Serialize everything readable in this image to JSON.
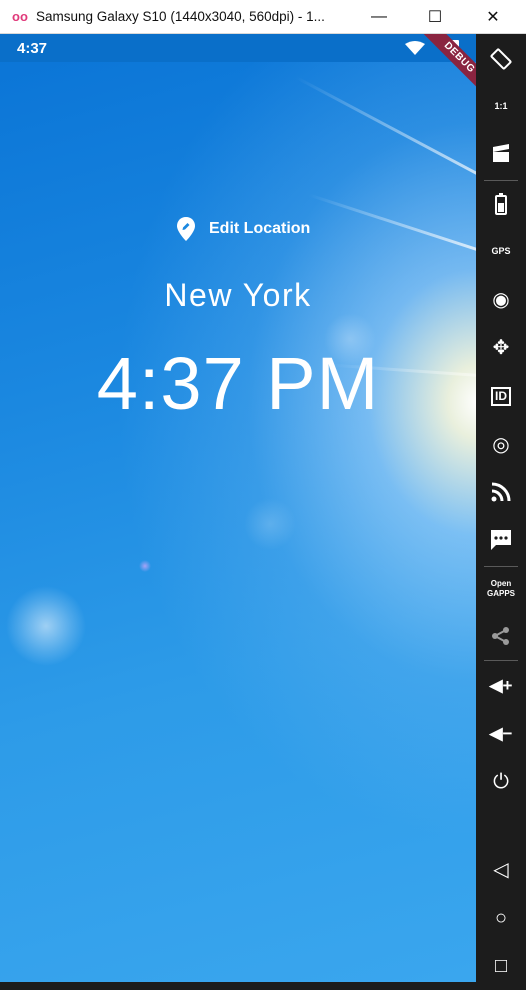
{
  "window": {
    "title": "Samsung Galaxy S10 (1440x3040, 560dpi) - 1...",
    "logo": "oo",
    "minimize": "—",
    "maximize": "☐",
    "close": "✕"
  },
  "status_bar": {
    "time": "4:37",
    "debug_label": "DEBUG"
  },
  "main": {
    "edit_location_label": "Edit Location",
    "location": "New York",
    "time": "4:37 PM"
  },
  "toolbar": {
    "items": [
      {
        "name": "rotate-icon",
        "glyph": "⟲"
      },
      {
        "name": "pixel-perfect-icon",
        "glyph": "1:1"
      },
      {
        "name": "screencast-icon",
        "glyph": "🎬"
      },
      {
        "name": "battery-icon",
        "glyph": "▮"
      },
      {
        "name": "gps-icon",
        "glyph": "GPS"
      },
      {
        "name": "webcam-icon",
        "glyph": "◉"
      },
      {
        "name": "move-icon",
        "glyph": "✥"
      },
      {
        "name": "id-icon",
        "glyph": "ID"
      },
      {
        "name": "disk-icon",
        "glyph": "◎"
      },
      {
        "name": "cast-icon",
        "glyph": "◔"
      },
      {
        "name": "sms-icon",
        "glyph": "…"
      },
      {
        "name": "open-gapps-icon",
        "glyph": "Open\nGAPPS"
      },
      {
        "name": "share-icon",
        "glyph": "⋖"
      },
      {
        "name": "volume-up-icon",
        "glyph": "◀+"
      },
      {
        "name": "volume-down-icon",
        "glyph": "◀−"
      },
      {
        "name": "power-icon",
        "glyph": "⏻"
      },
      {
        "name": "back-icon",
        "glyph": "◁"
      },
      {
        "name": "home-icon",
        "glyph": "○"
      },
      {
        "name": "recents-icon",
        "glyph": "□"
      }
    ]
  }
}
